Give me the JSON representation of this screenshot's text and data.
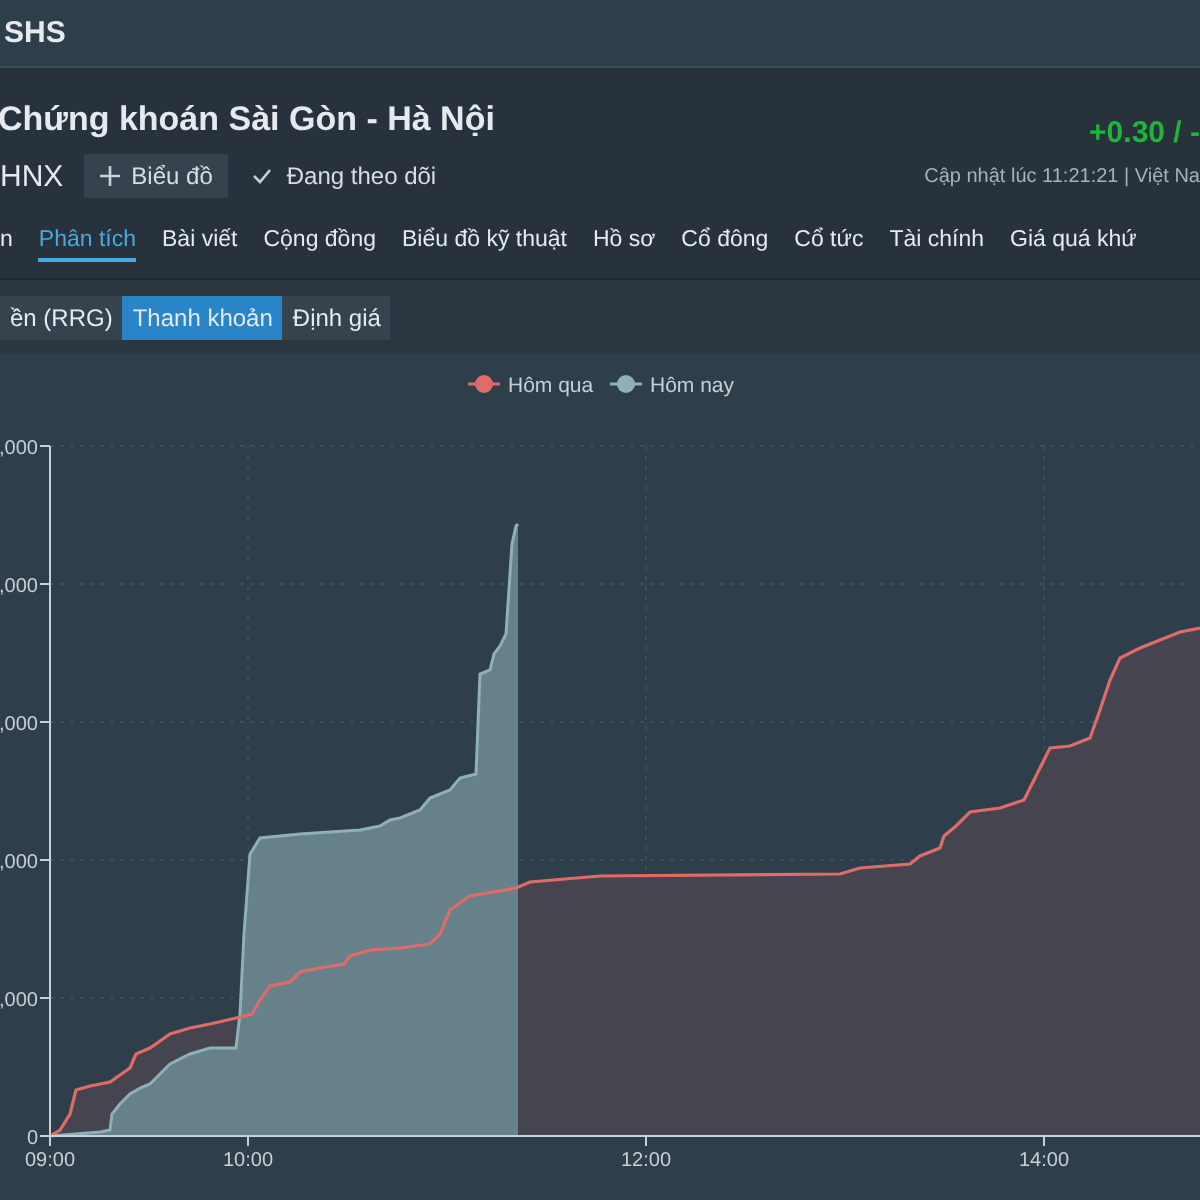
{
  "topbar": {
    "symbol": "SHS"
  },
  "header": {
    "company": "Chứng khoán Sài Gòn - Hà Nội",
    "exchange": "HNX",
    "chart_button": "Biểu đồ",
    "follow": {
      "label": "Đang theo dõi",
      "on": true
    },
    "change": "+0.30 / -",
    "updated": "Cập nhật lúc  11:21:21 | Việt Na"
  },
  "tabs": [
    {
      "label": "n",
      "selected": false
    },
    {
      "label": "Phân tích",
      "selected": true
    },
    {
      "label": "Bài viết",
      "selected": false
    },
    {
      "label": "Cộng đồng",
      "selected": false
    },
    {
      "label": "Biểu đồ kỹ thuật",
      "selected": false
    },
    {
      "label": "Hồ sơ",
      "selected": false
    },
    {
      "label": "Cổ đông",
      "selected": false
    },
    {
      "label": "Cổ tức",
      "selected": false
    },
    {
      "label": "Tài chính",
      "selected": false
    },
    {
      "label": "Giá quá khứ",
      "selected": false
    }
  ],
  "subtabs": [
    {
      "label": "ền (RRG)",
      "selected": false
    },
    {
      "label": "Thanh khoản",
      "selected": true
    },
    {
      "label": "Định giá",
      "selected": false
    }
  ],
  "chart": {
    "legend": [
      {
        "name": "Hôm qua",
        "color": "#e06b6b"
      },
      {
        "name": "Hôm nay",
        "color": "#8fb0b8"
      }
    ],
    "y_ticks": [
      ",000",
      ",000",
      ",000",
      ",000",
      ",000",
      "0"
    ],
    "x_ticks": [
      "09:00",
      "10:00",
      "12:00",
      "14:00"
    ]
  }
}
